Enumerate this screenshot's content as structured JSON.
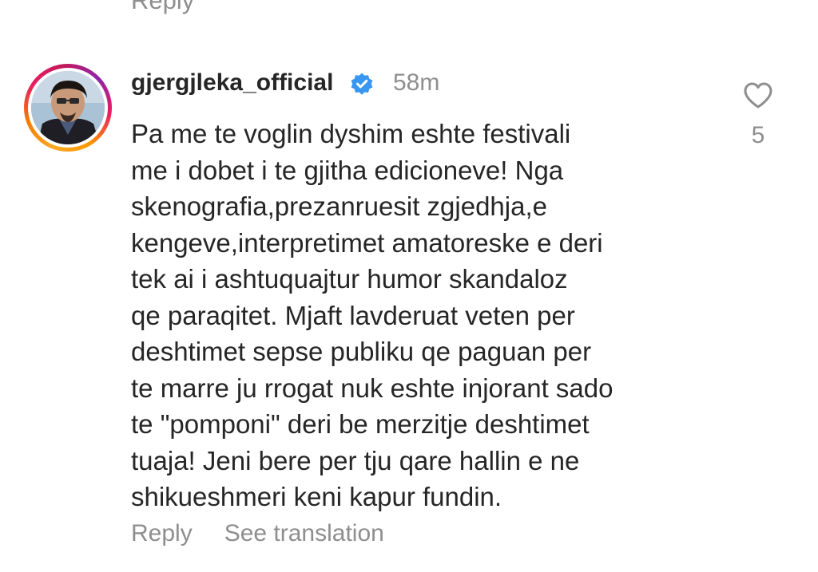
{
  "previous_comment": {
    "reply_label": "Reply"
  },
  "comment": {
    "username": "gjergjleka_official",
    "verified_icon": "verified-badge-icon",
    "time": "58m",
    "lines": [
      "Pa me te voglin dyshim eshte festivali",
      "me i dobet i te gjitha edicioneve! Nga",
      "skenografia,prezanruesit zgjedhja,e",
      "kengeve,interpretimet amatoreske e deri",
      "tek ai i ashtuquajtur humor skandaloz",
      "qe paraqitet. Mjaft lavderuat veten per",
      "deshtimet sepse publiku qe paguan per",
      "te marre ju rrogat nuk eshte injorant sado",
      "te \"pomponi\" deri be merzitje deshtimet",
      "tuaja! Jeni bere per tju qare hallin e ne",
      "shikueshmeri keni kapur fundin."
    ],
    "reply_label": "Reply",
    "translate_label": "See translation",
    "like_icon": "heart-icon",
    "like_count": "5"
  },
  "colors": {
    "text": "#262626",
    "muted": "#8e8e8e",
    "verified": "#3897f0",
    "background": "#ffffff"
  }
}
